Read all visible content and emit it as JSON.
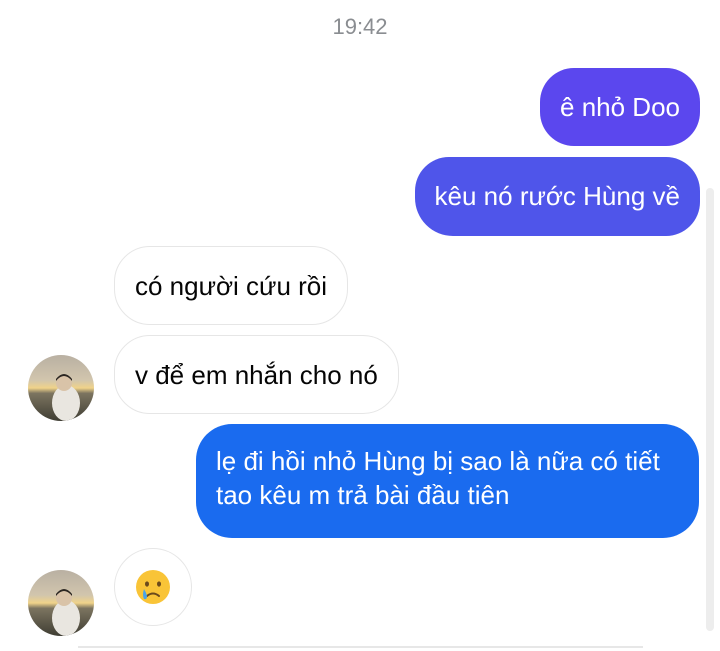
{
  "timestamp": "19:42",
  "messages": [
    {
      "side": "outgoing",
      "text": "ê nhỏ Doo"
    },
    {
      "side": "outgoing",
      "text": "kêu nó rước Hùng về"
    },
    {
      "side": "incoming",
      "text": "có người cứu rồi"
    },
    {
      "side": "incoming",
      "text": "v để em nhắn cho nó"
    },
    {
      "side": "outgoing",
      "text": "lẹ đi hồi nhỏ Hùng bị sao là nữa có tiết tao kêu m trả bài đầu tiên"
    },
    {
      "side": "incoming",
      "emoji": "crying-face"
    }
  ],
  "colors": {
    "outgoing_top": "#5b47ee",
    "outgoing_mid": "#4f55ea",
    "outgoing_bottom": "#1a6bef",
    "incoming_bg": "#ffffff",
    "timestamp": "#8a8d91"
  }
}
